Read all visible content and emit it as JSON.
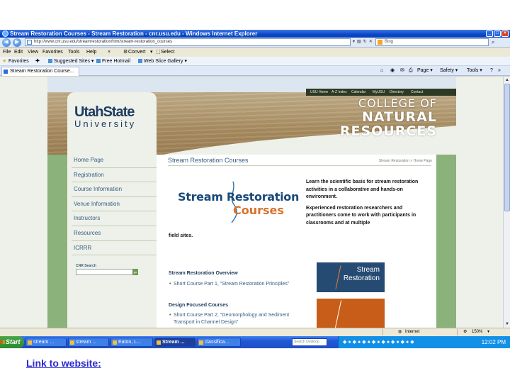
{
  "browser": {
    "title": "Stream Restoration Courses - Stream Restoration - cnr.usu.edu - Windows Internet Explorer",
    "address": "http://www.cnr.usu.edu/streamrestoration/htm/stream-restoration_courses",
    "search_placeholder": "Bing",
    "menu": [
      "File",
      "Edit",
      "View",
      "Favorites",
      "Tools",
      "Help"
    ],
    "menu_extra": [
      "Convert",
      "Select"
    ],
    "favorites_label": "Favorites",
    "favorites_items": [
      "Suggested Sites",
      "Free Hotmail",
      "Web Slice Gallery"
    ],
    "tab_label": "Stream Restoration Course...",
    "commands": [
      "Page",
      "Safety",
      "Tools"
    ],
    "status_zone": "Internet",
    "zoom": "150%"
  },
  "site": {
    "top_links": [
      "USU Home",
      "A-Z Index",
      "Calendar",
      "MyUSU",
      "Directory",
      "Contact"
    ],
    "college_line1": "COLLEGE OF",
    "college_line2": "NATURAL RESOURCES",
    "logo_line1": "UtahState",
    "logo_line2": "University",
    "nav": [
      "Home Page",
      "Registration",
      "Course Information",
      "Venue Information",
      "Instructors",
      "Resources",
      "ICRRR"
    ],
    "cnr_search_label": "CNR Search",
    "page_title": "Stream Restoration Courses",
    "breadcrumb": "Stream Restoration > Home Page",
    "logo_stream": "Stream Restoration",
    "logo_courses": "Courses",
    "blurb_p1": "Learn the scientific basis for stream restoration activities in a collaborative and hands-on environment.",
    "blurb_p2": "Experienced restoration researchers and practitioners come to work with participants in classrooms and at multiple",
    "field_sites": "field sites.",
    "overview_heading": "Stream Restoration Overview",
    "overview_link": "Short Course Part 1, \"Stream Restoration Principles\"",
    "design_heading": "Design Focused Courses",
    "design_link": "Short Course Part 2, \"Geomorphology and Sediment Transport in Channel Design\"",
    "tile_text_1": "Stream",
    "tile_text_2": "Restoration"
  },
  "taskbar": {
    "start": "Start",
    "tasks": [
      "stream ...",
      "stream ...",
      "Eaton, L...",
      "Stream ...",
      "classifica..."
    ],
    "desktop_search": "Search Desktop",
    "clock": "12:02 PM"
  },
  "caption": "Link to website:"
}
